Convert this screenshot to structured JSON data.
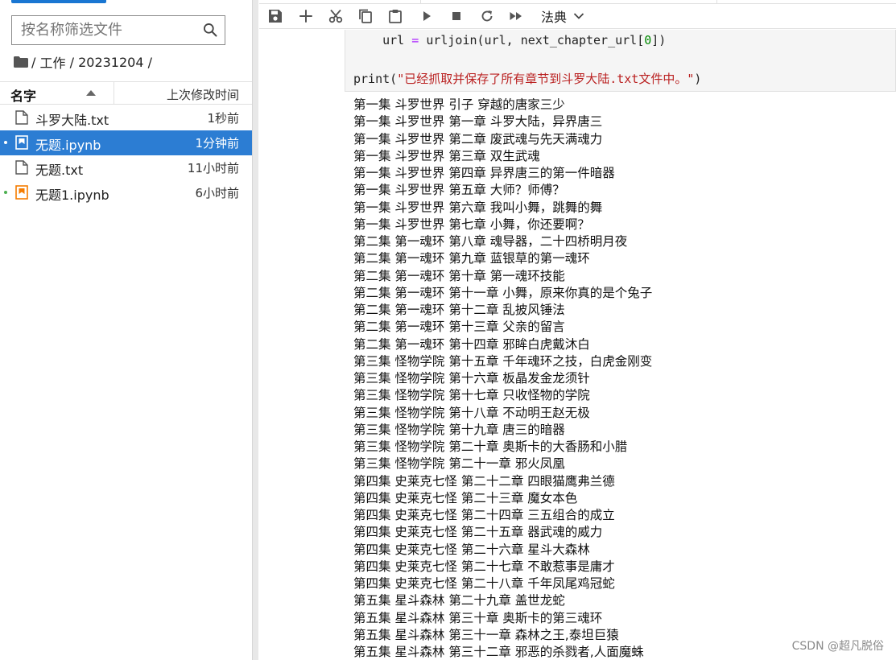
{
  "file_browser": {
    "search_placeholder": "按名称筛选文件",
    "breadcrumb": [
      "/",
      "工作",
      "/",
      "20231204",
      "/"
    ],
    "column_name": "名字",
    "column_modified": "上次修改时间",
    "files": [
      {
        "name": "斗罗大陆.txt",
        "modified": "1秒前",
        "type": "text-file-icon",
        "selected": false,
        "running": false
      },
      {
        "name": "无题.ipynb",
        "modified": "1分钟前",
        "type": "notebook-icon",
        "selected": true,
        "running": true
      },
      {
        "name": "无题.txt",
        "modified": "11小时前",
        "type": "text-file-icon",
        "selected": false,
        "running": false
      },
      {
        "name": "无题1.ipynb",
        "modified": "6小时前",
        "type": "notebook-icon",
        "selected": false,
        "running": true
      }
    ]
  },
  "toolbar": {
    "buttons": [
      "save-icon",
      "add-cell-icon",
      "cut-icon",
      "copy-icon",
      "paste-icon",
      "run-icon",
      "stop-icon",
      "restart-icon",
      "fast-forward-icon"
    ],
    "kernel_label": "法典"
  },
  "code_cell": {
    "line1": {
      "indent": "    ",
      "var": "url",
      "eq": "=",
      "call": "urljoin(url, next_chapter_url[",
      "idx": "0",
      "close": "])"
    },
    "line2": {
      "fn": "print(",
      "str": "\"已经抓取并保存了所有章节到斗罗大陆.txt文件中。\"",
      "close": ")"
    }
  },
  "output_lines": [
    "第一集 斗罗世界 引子 穿越的唐家三少",
    "第一集 斗罗世界 第一章 斗罗大陆，异界唐三",
    "第一集 斗罗世界 第二章 废武魂与先天满魂力",
    "第一集 斗罗世界 第三章 双生武魂",
    "第一集 斗罗世界 第四章 异界唐三的第一件暗器",
    "第一集 斗罗世界 第五章 大师？师傅？",
    "第一集 斗罗世界 第六章 我叫小舞，跳舞的舞",
    "第一集 斗罗世界 第七章 小舞，你还要啊？",
    "第二集 第一魂环 第八章 魂导器，二十四桥明月夜",
    "第二集 第一魂环 第九章 蓝银草的第一魂环",
    "第二集 第一魂环 第十章 第一魂环技能",
    "第二集 第一魂环 第十一章 小舞，原来你真的是个兔子",
    "第二集 第一魂环 第十二章 乱披风锤法",
    "第二集 第一魂环 第十三章 父亲的留言",
    "第二集 第一魂环 第十四章 邪眸白虎戴沐白",
    "第三集 怪物学院 第十五章 千年魂环之技，白虎金刚变",
    "第三集 怪物学院 第十六章 板晶发金龙须针",
    "第三集 怪物学院 第十七章 只收怪物的学院",
    "第三集 怪物学院 第十八章 不动明王赵无极",
    "第三集 怪物学院 第十九章 唐三的暗器",
    "第三集 怪物学院 第二十章 奥斯卡的大香肠和小腊",
    "第三集 怪物学院 第二十一章 邪火凤凰",
    "第四集 史莱克七怪 第二十二章 四眼猫鹰弗兰德",
    "第四集 史莱克七怪 第二十三章 魔女本色",
    "第四集 史莱克七怪 第二十四章 三五组合的成立",
    "第四集 史莱克七怪 第二十五章 器武魂的威力",
    "第四集 史莱克七怪 第二十六章 星斗大森林",
    "第四集 史莱克七怪 第二十七章 不敢惹事是庸才",
    "第四集 史莱克七怪 第二十八章 千年凤尾鸡冠蛇",
    "第五集 星斗森林 第二十九章 盖世龙蛇",
    "第五集 星斗森林 第三十章 奥斯卡的第三魂环",
    "第五集 星斗森林 第三十一章 森林之王,泰坦巨猿",
    "第五集 星斗森林 第三十二章 邪恶的杀戮者,人面魔蛛"
  ],
  "watermark": "CSDN @超凡脱俗",
  "colors": {
    "accent": "#1976d2",
    "selected_row": "#2c7dd3",
    "running_dot": "#4caf50",
    "notebook_icon": "#f57c00"
  }
}
